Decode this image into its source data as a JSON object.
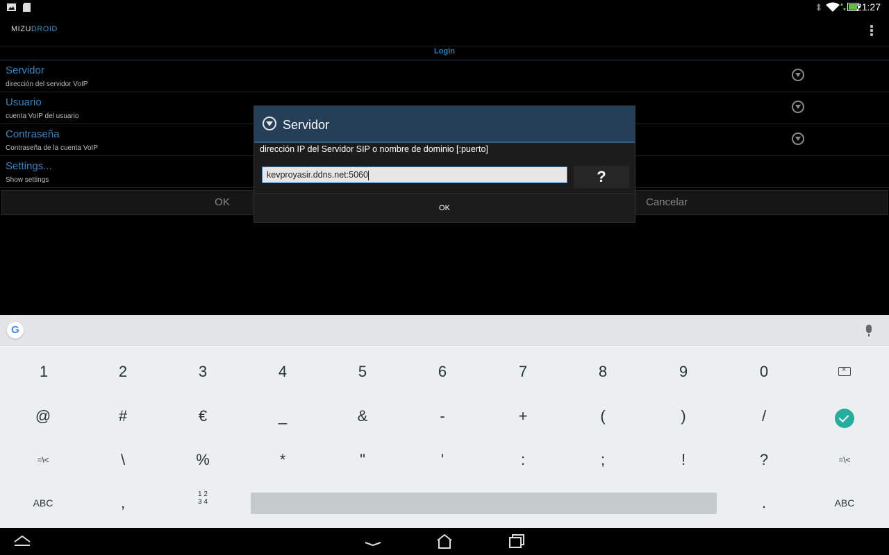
{
  "status_bar": {
    "time": "21:27",
    "icons": [
      "image-icon",
      "sd-card-icon",
      "bluetooth-icon",
      "wifi-icon",
      "battery-icon"
    ]
  },
  "action_bar": {
    "logo": {
      "part1": "MIZU",
      "part2": "DROID"
    },
    "overflow_icon": "more-vert-icon"
  },
  "section_header": "Login",
  "preferences": [
    {
      "title": "Servidor",
      "summary": "dirección del servidor VoIP",
      "icon": "chevron-down-circle-icon"
    },
    {
      "title": "Usuario",
      "summary": "cuenta VoIP del usuario",
      "icon": "chevron-down-circle-icon"
    },
    {
      "title": "Contraseña",
      "summary": "Contraseña de la cuenta VoIP",
      "icon": "chevron-down-circle-icon"
    },
    {
      "title": "Settings...",
      "summary": "Show settings"
    }
  ],
  "background_buttons": {
    "ok": "OK",
    "cancel": "Cancelar"
  },
  "dialog": {
    "title": "Servidor",
    "message": "dirección IP del Servidor SIP o nombre de dominio [:puerto]",
    "input_value": "kevproyasir.ddns.net:5060",
    "help_label": "?",
    "ok_label": "OK"
  },
  "keyboard": {
    "row1": [
      "1",
      "2",
      "3",
      "4",
      "5",
      "6",
      "7",
      "8",
      "9",
      "0"
    ],
    "row2": [
      "@",
      "#",
      "€",
      "_",
      "&",
      "-",
      "+",
      "(",
      ")",
      "/"
    ],
    "row3": [
      "=\\<",
      "\\",
      "%",
      "*",
      "\"",
      "'",
      ":",
      ";",
      "!",
      "?",
      "=\\<"
    ],
    "row4": {
      "left": "ABC",
      "comma": ",",
      "numpad": "1 2\n3 4",
      "period": ".",
      "right": "ABC"
    }
  },
  "colors": {
    "accent": "#3a83bf",
    "dialog_header": "#263f58",
    "enter": "#27ad9e",
    "keyboard_bg": "#eceff1"
  }
}
